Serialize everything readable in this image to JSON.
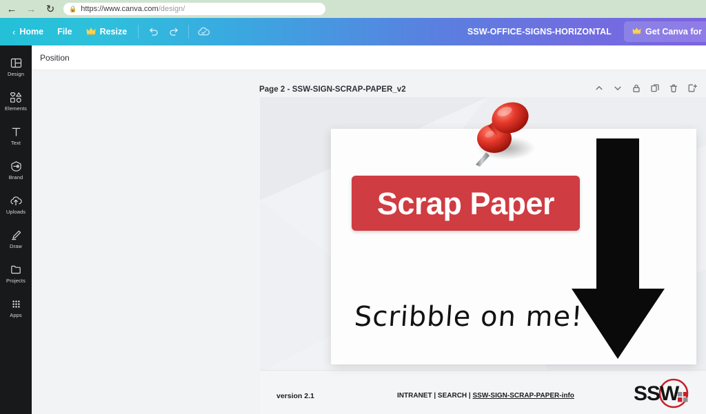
{
  "browser": {
    "back_icon": "arrow-left-icon",
    "forward_icon": "arrow-right-icon",
    "reload_icon": "reload-icon",
    "lock_icon": "lock-icon",
    "url_prefix": "https://www.canva.com",
    "url_suffix": "/design/"
  },
  "toolbar": {
    "home_label": "Home",
    "home_chevron": "chevron-left-icon",
    "file_label": "File",
    "resize_label": "Resize",
    "resize_icon": "crown-icon",
    "undo_icon": "undo-icon",
    "redo_icon": "redo-icon",
    "cloud_icon": "cloud-check-icon",
    "doc_title": "SSW-OFFICE-SIGNS-HORIZONTAL",
    "pro_button_label": "Get Canva for",
    "pro_button_icon": "crown-icon",
    "accent_start": "#23c0d8",
    "accent_end": "#7b63e2"
  },
  "sidebar": {
    "items": [
      {
        "label": "Design",
        "icon": "design-icon"
      },
      {
        "label": "Elements",
        "icon": "elements-icon"
      },
      {
        "label": "Text",
        "icon": "text-icon"
      },
      {
        "label": "Brand",
        "icon": "brand-icon"
      },
      {
        "label": "Uploads",
        "icon": "upload-cloud-icon"
      },
      {
        "label": "Draw",
        "icon": "pen-icon"
      },
      {
        "label": "Projects",
        "icon": "folder-icon"
      },
      {
        "label": "Apps",
        "icon": "grid-dots-icon"
      }
    ]
  },
  "property_bar": {
    "position_label": "Position"
  },
  "page": {
    "title": "Page 2 - SSW-SIGN-SCRAP-PAPER_v2",
    "actions": [
      {
        "name": "move-page-up-button",
        "icon": "chevron-up-icon"
      },
      {
        "name": "move-page-down-button",
        "icon": "chevron-down-icon"
      },
      {
        "name": "lock-page-button",
        "icon": "lock-icon"
      },
      {
        "name": "duplicate-page-button",
        "icon": "duplicate-icon"
      },
      {
        "name": "delete-page-button",
        "icon": "trash-icon"
      },
      {
        "name": "add-page-button",
        "icon": "add-page-icon"
      }
    ]
  },
  "design": {
    "banner_text": "Scrap Paper",
    "banner_color": "#cf3c42",
    "scribble_text": "Scribble on me!",
    "arrow_icon": "down-arrow-icon",
    "arrow_color": "#0a0a0a",
    "pushpin_icon": "pushpin-icon",
    "pushpin_color": "#d62b22",
    "footer": {
      "version": "version 2.1",
      "link_intranet": "INTRANET",
      "separator": " | ",
      "link_search": "SEARCH",
      "link_info": "SSW-SIGN-SCRAP-PAPER-info"
    },
    "logo": {
      "text": "SSW",
      "accent_color": "#c8202a"
    }
  }
}
